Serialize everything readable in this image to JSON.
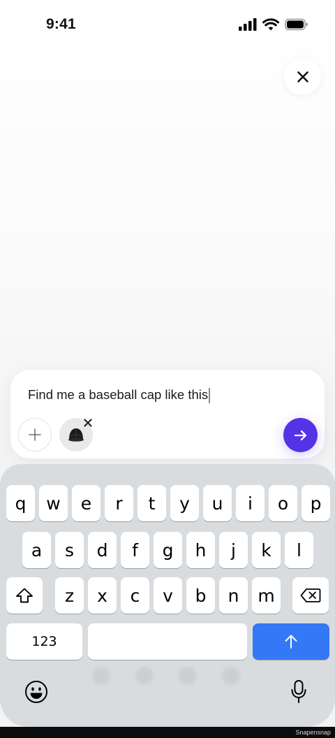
{
  "status_bar": {
    "time": "9:41"
  },
  "composer": {
    "prompt_text": "Find me a baseball cap like this"
  },
  "keyboard": {
    "row1": [
      "q",
      "w",
      "e",
      "r",
      "t",
      "y",
      "u",
      "i",
      "o",
      "p"
    ],
    "row2": [
      "a",
      "s",
      "d",
      "f",
      "g",
      "h",
      "j",
      "k",
      "l"
    ],
    "row3": [
      "z",
      "x",
      "c",
      "v",
      "b",
      "n",
      "m"
    ],
    "numbers_label": "123",
    "return_key_color": "#3478f6"
  },
  "colors": {
    "send_button": "#5433e6",
    "keyboard_bg": "#d9dcdf"
  },
  "icons": {
    "close": "close-icon",
    "add": "plus-icon",
    "attachment": "baseball-cap-icon",
    "send": "arrow-right-icon",
    "shift": "shift-icon",
    "delete": "backspace-icon",
    "return": "arrow-up-icon",
    "emoji": "emoji-icon",
    "dictation": "microphone-icon"
  },
  "watermark": "Snapensnap"
}
